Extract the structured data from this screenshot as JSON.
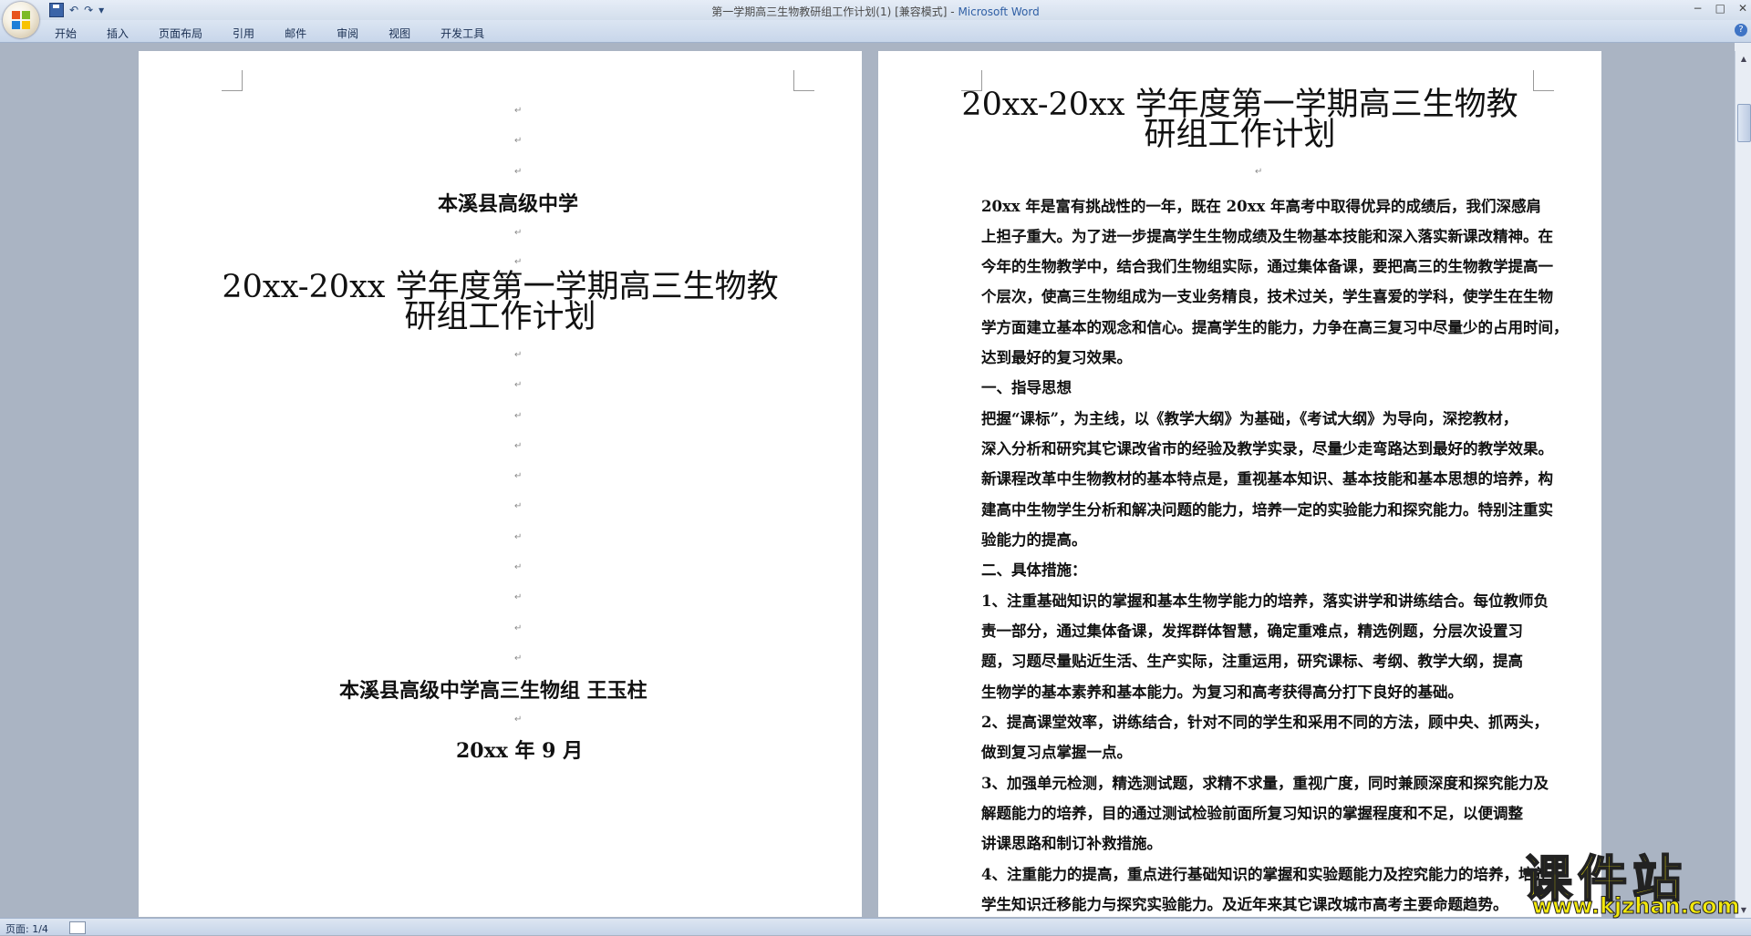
{
  "window": {
    "title_doc": "第一学期高三生物教研组工作计划(1) [兼容模式]",
    "title_sep": " - ",
    "title_app": "Microsoft Word",
    "minimize": "−",
    "restore": "□",
    "close": "✕"
  },
  "qat": {
    "undo": "↶",
    "redo": "↷",
    "more": "▾"
  },
  "ribbon": {
    "tabs": [
      "开始",
      "插入",
      "页面布局",
      "引用",
      "邮件",
      "审阅",
      "视图",
      "开发工具"
    ],
    "help": "?"
  },
  "page1": {
    "school": "本溪县高级中学",
    "title_line1": "20xx-20xx 学年度第一学期高三生物教",
    "title_line2": "研组工作计划",
    "author": "本溪县高级中学高三生物组  王玉柱",
    "date": "20xx 年 9 月"
  },
  "page2": {
    "title_line1": "20xx-20xx 学年度第一学期高三生物教",
    "title_line2": "研组工作计划",
    "lines": [
      "      20xx 年是富有挑战性的一年，既在 20xx 年高考中取得优异的成绩后，我们深感肩",
      "上担子重大。为了进一步提高学生生物成绩及生物基本技能和深入落实新课改精神。在",
      "今年的生物教学中，结合我们生物组实际，通过集体备课，要把高三的生物教学提高一",
      "个层次，使高三生物组成为一支业务精良，技术过关，学生喜爱的学科，使学生在生物",
      "学方面建立基本的观念和信心。提高学生的能力，力争在高三复习中尽量少的占用时间，",
      "达到最好的复习效果。",
      "一、指导思想",
      "      把握“课标”，为主线，以《教学大纲》为基础，《考试大纲》为导向，深挖教材，",
      "深入分析和研究其它课改省市的经验及教学实录，尽量少走弯路达到最好的教学效果。",
      "新课程改革中生物教材的基本特点是，重视基本知识、基本技能和基本思想的培养，构",
      "建高中生物学生分析和解决问题的能力，培养一定的实验能力和探究能力。特别注重实",
      "验能力的提高。",
      "二、具体措施：",
      "1、注重基础知识的掌握和基本生物学能力的培养，落实讲学和讲练结合。每位教师负",
      "    责一部分，通过集体备课，发挥群体智慧，确定重难点，精选例题，分层次设置习",
      "    题，习题尽量贴近生活、生产实际，注重运用，研究课标、考纲、教学大纲，提高",
      "    生物学的基本素养和基本能力。为复习和高考获得高分打下良好的基础。",
      "2、提高课堂效率，讲练结合，针对不同的学生和采用不同的方法，顾中央、抓两头，",
      "    做到复习点掌握一点。",
      "3、加强单元检测，精选测试题，求精不求量，重视广度，同时兼顾深度和探究能力及",
      "    解题能力的培养，目的通过测试检验前面所复习知识的掌握程度和不足，以便调整",
      "    讲课思路和制订补救措施。",
      "4、注重能力的提高，重点进行基础知识的掌握和实验题能力及控究能力的培养，培养",
      "    学生知识迁移能力与探究实验能力。及近年来其它课改城市高考主要命题趋势。"
    ]
  },
  "statusbar": {
    "page": "页面: 1/4"
  },
  "watermark": {
    "cn": "课件站",
    "url": "www.kjzhan.com"
  }
}
